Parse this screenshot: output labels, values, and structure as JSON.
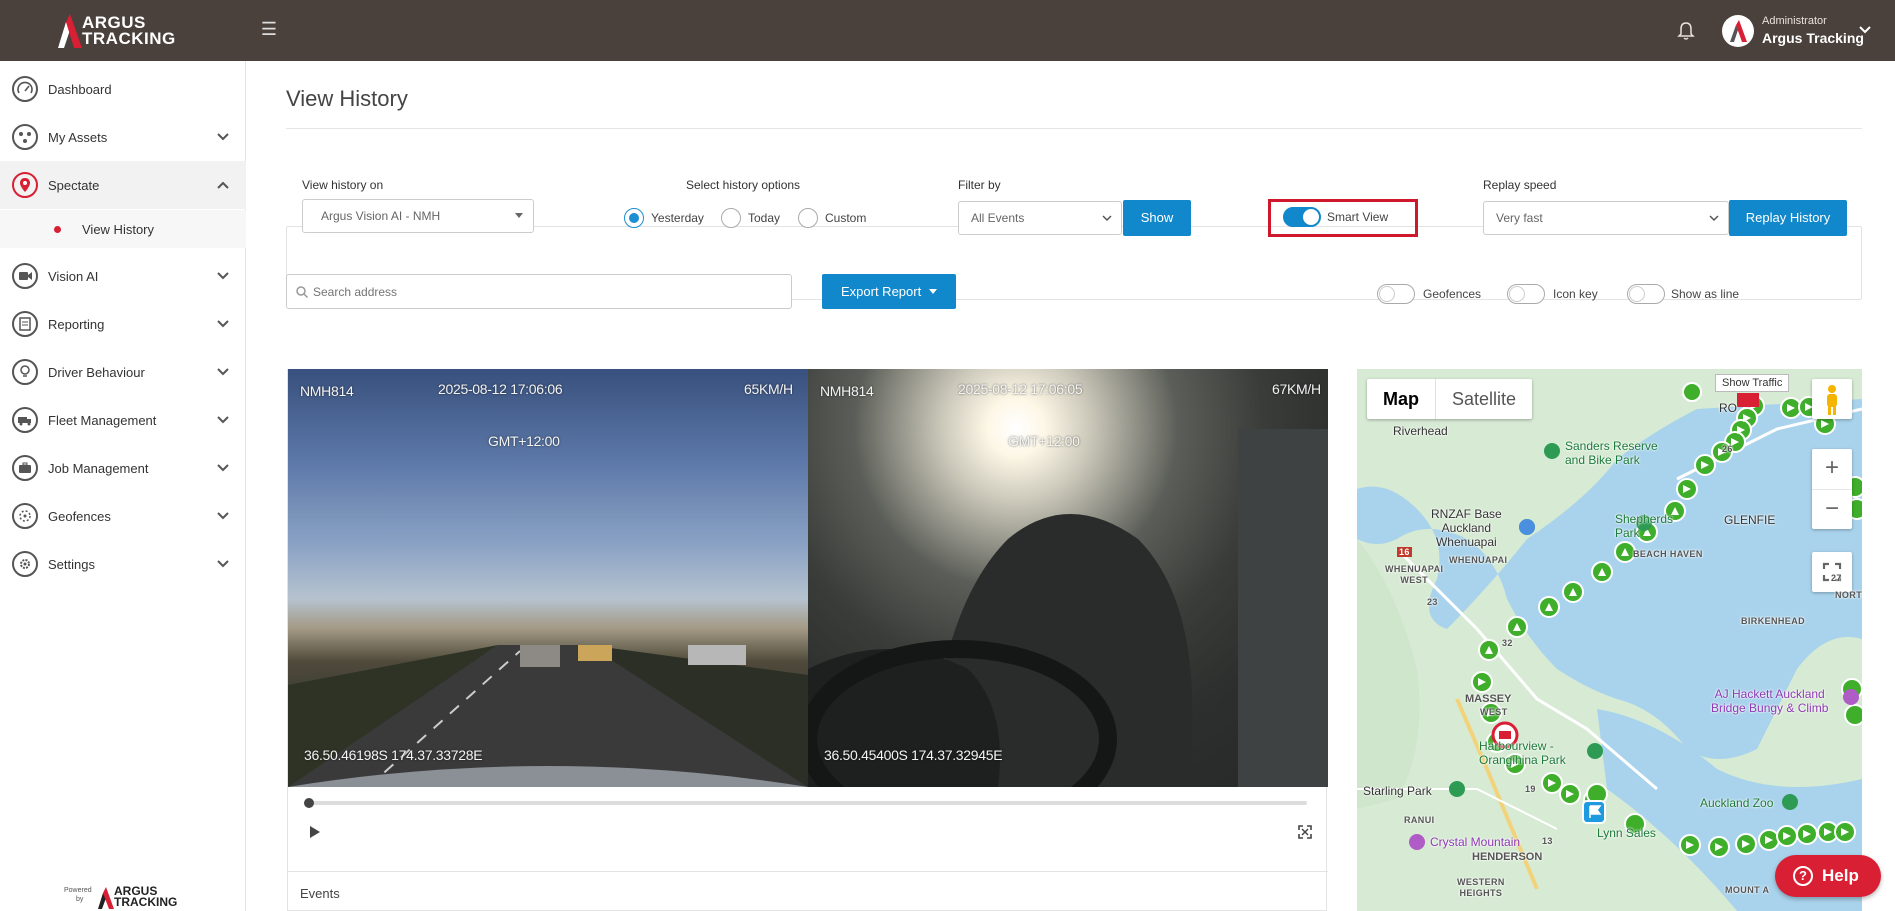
{
  "brand": {
    "logo_line1": "ARGUS",
    "logo_line2": "TRACKING",
    "accent": "#d81f33",
    "topbar": "#4a403c",
    "primary_button": "#1188cc"
  },
  "user": {
    "role": "Administrator",
    "name": "Argus Tracking"
  },
  "sidebar": {
    "items": [
      {
        "label": "Dashboard",
        "icon": "dashboard-gauge-icon"
      },
      {
        "label": "My Assets",
        "icon": "assets-icon"
      },
      {
        "label": "Spectate",
        "icon": "map-pin-icon"
      },
      {
        "label": "Vision AI",
        "icon": "camera-icon"
      },
      {
        "label": "Reporting",
        "icon": "report-icon"
      },
      {
        "label": "Driver Behaviour",
        "icon": "lightbulb-icon"
      },
      {
        "label": "Fleet Management",
        "icon": "truck-icon"
      },
      {
        "label": "Job Management",
        "icon": "briefcase-icon"
      },
      {
        "label": "Geofences",
        "icon": "geofence-icon"
      },
      {
        "label": "Settings",
        "icon": "gear-icon"
      }
    ],
    "subitem": "View History",
    "powered_by_line1": "Powered",
    "powered_by_line2": "by",
    "powered_logo_line1": "ARGUS",
    "powered_logo_line2": "TRACKING"
  },
  "page": {
    "title": "View History"
  },
  "filters": {
    "history_on_label": "View history on",
    "history_on_value": "Argus Vision AI - NMH",
    "history_options_label": "Select history options",
    "options": [
      "Yesterday",
      "Today",
      "Custom"
    ],
    "selected_option": "Yesterday",
    "filter_by_label": "Filter by",
    "filter_by_value": "All Events",
    "show_label": "Show",
    "smart_view_label": "Smart View",
    "smart_view_on": true,
    "replay_speed_label": "Replay speed",
    "replay_speed_value": "Very fast",
    "replay_label": "Replay History"
  },
  "toolbar": {
    "search_placeholder": "Search address",
    "export_label": "Export Report",
    "toggles": [
      "Geofences",
      "Icon key",
      "Show as line"
    ]
  },
  "video": {
    "cam1": {
      "plate": "NMH814",
      "timestamp": "2025-08-12 17:06:06",
      "speed": "65KM/H",
      "tz": "GMT+12:00",
      "coords": "36.50.46198S 174.37.33728E"
    },
    "cam2": {
      "plate": "NMH814",
      "timestamp": "2025-08-12 17:06:05",
      "speed": "67KM/H",
      "tz": "GMT+12:00",
      "coords": "36.50.45400S 174.37.32945E"
    },
    "progress": 0.0,
    "events_label": "Events"
  },
  "map": {
    "type_map": "Map",
    "type_satellite": "Satellite",
    "show_traffic": "Show Traffic",
    "labels": {
      "riverhead": "Riverhead",
      "sanders": "Sanders Reserve\nand Bike Park",
      "rnzaf": "RNZAF Base\nAuckland\nWhenuapai",
      "whenuapai": "WHENUAPAI",
      "whenuapai_w": "WHENUAPAI\nWEST",
      "shepherds": "Shepherds\nPark",
      "beach_haven": "BEACH HAVEN",
      "glenfield": "GLENFIE",
      "birkenhead": "BIRKENHEAD",
      "north": "NORTH",
      "massey": "MASSEY",
      "west": "WEST",
      "harbourview": "Harbourview -\nOrangihina Park",
      "aj_hackett": "AJ Hackett Auckland\nBridge Bungy & Climb",
      "starling": "Starling Park",
      "ranui": "RANUI",
      "auckland_zoo": "Auckland Zoo",
      "crystal": "Crystal Mountain",
      "henderson": "HENDERSON",
      "western_heights": "WESTERN\nHEIGHTS",
      "mount_albert": "MOUNT A",
      "lynn_sales": "Lynn Sales",
      "road_16": "16",
      "road_23": "23",
      "road_32": "32",
      "road_13": "13",
      "road_19": "19",
      "road_26": "26",
      "road_27": "27",
      "road_ro": "RO"
    }
  },
  "help": {
    "label": "Help"
  }
}
